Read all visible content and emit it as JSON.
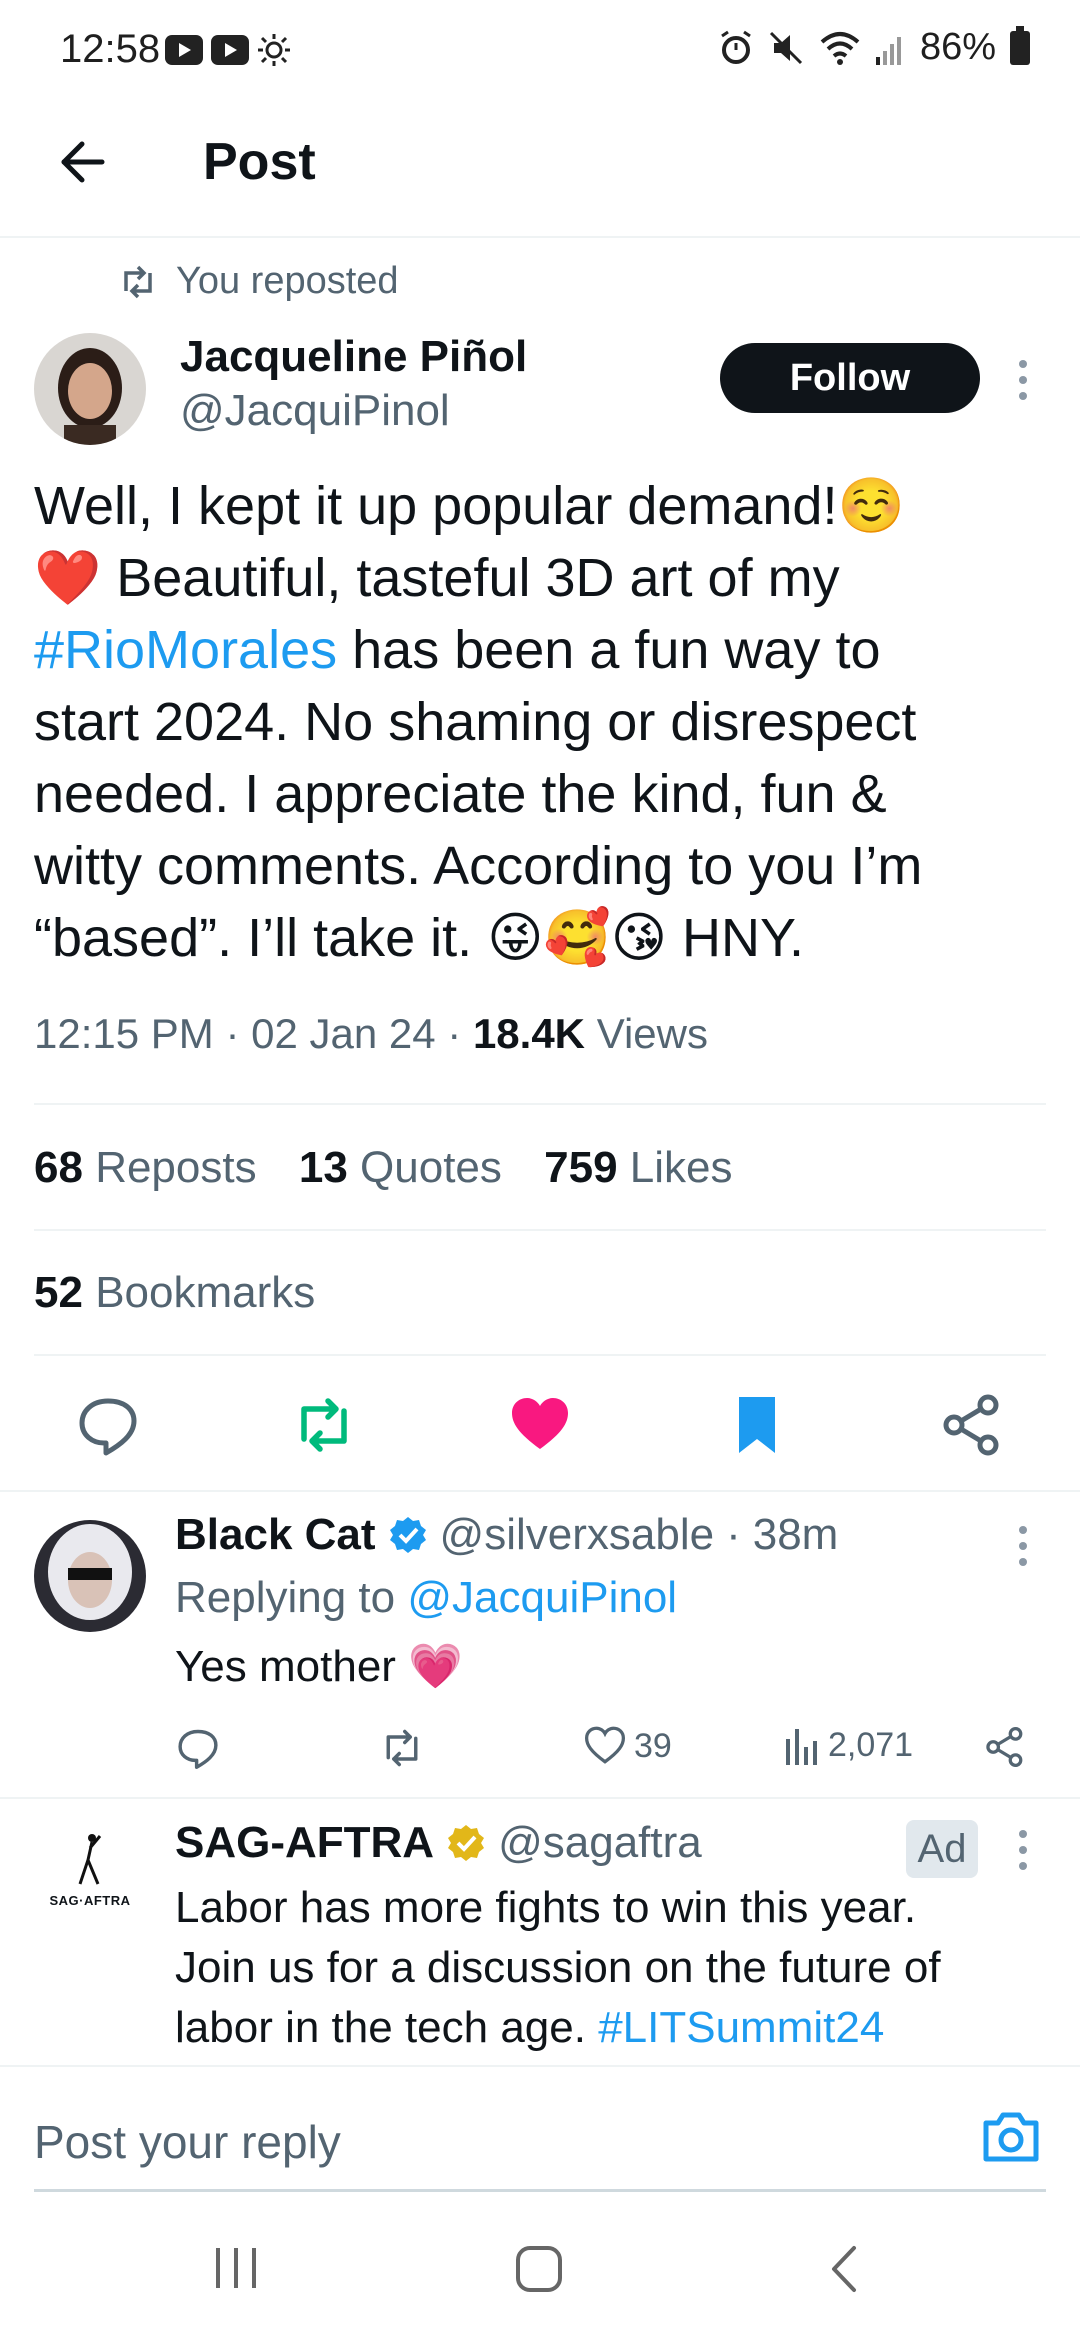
{
  "status_bar": {
    "time": "12:58",
    "battery": "86%"
  },
  "header": {
    "title": "Post"
  },
  "post": {
    "repost_label": "You reposted",
    "author_name": "Jacqueline Piñol",
    "author_handle": "@JacquiPinol",
    "follow_label": "Follow",
    "text_part1": "Well, I kept it up popular demand!☺️\n❤️ Beautiful, tasteful 3D art of my\n",
    "hashtag": "#RioMorales",
    "text_part2": " has been a fun way to\nstart 2024. No shaming or disrespect\nneeded. I appreciate the kind, fun &\nwitty comments. According to you I’m\n“based”. I’ll take it. 😜🥰😘 HNY.",
    "time": "12:15 PM",
    "date": "02 Jan 24",
    "views_count": "18.4K",
    "views_label": "Views",
    "reposts_count": "68",
    "reposts_label": "Reposts",
    "quotes_count": "13",
    "quotes_label": "Quotes",
    "likes_count": "759",
    "likes_label": "Likes",
    "bookmarks_count": "52",
    "bookmarks_label": "Bookmarks"
  },
  "reply": {
    "name": "Black Cat",
    "handle": "@silverxsable",
    "age": "38m",
    "replying_prefix": "Replying to",
    "replying_to": "@JacquiPinol",
    "text": "Yes mother 💗",
    "likes": "39",
    "views": "2,071"
  },
  "ad": {
    "logo_text": "SAG·AFTRA",
    "name": "SAG-AFTRA",
    "handle": "@sagaftra",
    "badge": "Ad",
    "text_line1": "Labor has more fights to win this year.",
    "text_line2": "Join us for a discussion on the future of",
    "text_line3": "labor in the tech age. ",
    "hashtag": "#LITSummit24"
  },
  "composer": {
    "placeholder": "Post your reply"
  },
  "colors": {
    "accent": "#1d9bf0",
    "like": "#f91880",
    "repost": "#00ba7c"
  }
}
